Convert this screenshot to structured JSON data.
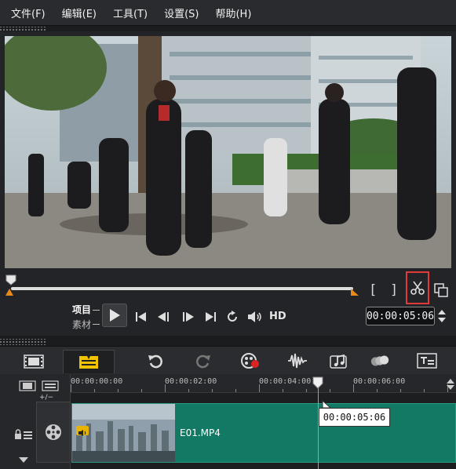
{
  "menu": {
    "items": [
      {
        "label": "文件(F)"
      },
      {
        "label": "编辑(E)"
      },
      {
        "label": "工具(T)"
      },
      {
        "label": "设置(S)"
      },
      {
        "label": "帮助(H)"
      }
    ]
  },
  "preview": {
    "mode_project": "项目",
    "mode_clip": "素材",
    "hd_label": "HD",
    "timecode": "00:00:05:06",
    "trim_in_glyph": "[",
    "trim_out_glyph": "]"
  },
  "timeline": {
    "ruler_labels": [
      "00:00:00:00",
      "00:00:02:00",
      "00:00:04:00",
      "00:00:06:00"
    ],
    "zoom_glyph": "+/−",
    "clip_name": "E01.MP4",
    "tooltip_timecode": "00:00:05:06"
  },
  "colors": {
    "accent_red": "#e23a3a",
    "clip_teal": "#127a64",
    "active_tab_yellow": "#f2c400",
    "playhead_blue": "#6aa9ff",
    "marker_orange": "#e88a1a"
  }
}
